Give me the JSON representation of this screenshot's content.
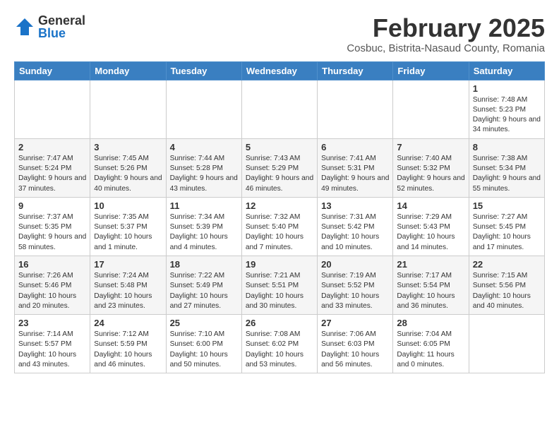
{
  "logo": {
    "general": "General",
    "blue": "Blue"
  },
  "header": {
    "month": "February 2025",
    "location": "Cosbuc, Bistrita-Nasaud County, Romania"
  },
  "days_of_week": [
    "Sunday",
    "Monday",
    "Tuesday",
    "Wednesday",
    "Thursday",
    "Friday",
    "Saturday"
  ],
  "weeks": [
    [
      {
        "day": "",
        "info": ""
      },
      {
        "day": "",
        "info": ""
      },
      {
        "day": "",
        "info": ""
      },
      {
        "day": "",
        "info": ""
      },
      {
        "day": "",
        "info": ""
      },
      {
        "day": "",
        "info": ""
      },
      {
        "day": "1",
        "info": "Sunrise: 7:48 AM\nSunset: 5:23 PM\nDaylight: 9 hours and 34 minutes."
      }
    ],
    [
      {
        "day": "2",
        "info": "Sunrise: 7:47 AM\nSunset: 5:24 PM\nDaylight: 9 hours and 37 minutes."
      },
      {
        "day": "3",
        "info": "Sunrise: 7:45 AM\nSunset: 5:26 PM\nDaylight: 9 hours and 40 minutes."
      },
      {
        "day": "4",
        "info": "Sunrise: 7:44 AM\nSunset: 5:28 PM\nDaylight: 9 hours and 43 minutes."
      },
      {
        "day": "5",
        "info": "Sunrise: 7:43 AM\nSunset: 5:29 PM\nDaylight: 9 hours and 46 minutes."
      },
      {
        "day": "6",
        "info": "Sunrise: 7:41 AM\nSunset: 5:31 PM\nDaylight: 9 hours and 49 minutes."
      },
      {
        "day": "7",
        "info": "Sunrise: 7:40 AM\nSunset: 5:32 PM\nDaylight: 9 hours and 52 minutes."
      },
      {
        "day": "8",
        "info": "Sunrise: 7:38 AM\nSunset: 5:34 PM\nDaylight: 9 hours and 55 minutes."
      }
    ],
    [
      {
        "day": "9",
        "info": "Sunrise: 7:37 AM\nSunset: 5:35 PM\nDaylight: 9 hours and 58 minutes."
      },
      {
        "day": "10",
        "info": "Sunrise: 7:35 AM\nSunset: 5:37 PM\nDaylight: 10 hours and 1 minute."
      },
      {
        "day": "11",
        "info": "Sunrise: 7:34 AM\nSunset: 5:39 PM\nDaylight: 10 hours and 4 minutes."
      },
      {
        "day": "12",
        "info": "Sunrise: 7:32 AM\nSunset: 5:40 PM\nDaylight: 10 hours and 7 minutes."
      },
      {
        "day": "13",
        "info": "Sunrise: 7:31 AM\nSunset: 5:42 PM\nDaylight: 10 hours and 10 minutes."
      },
      {
        "day": "14",
        "info": "Sunrise: 7:29 AM\nSunset: 5:43 PM\nDaylight: 10 hours and 14 minutes."
      },
      {
        "day": "15",
        "info": "Sunrise: 7:27 AM\nSunset: 5:45 PM\nDaylight: 10 hours and 17 minutes."
      }
    ],
    [
      {
        "day": "16",
        "info": "Sunrise: 7:26 AM\nSunset: 5:46 PM\nDaylight: 10 hours and 20 minutes."
      },
      {
        "day": "17",
        "info": "Sunrise: 7:24 AM\nSunset: 5:48 PM\nDaylight: 10 hours and 23 minutes."
      },
      {
        "day": "18",
        "info": "Sunrise: 7:22 AM\nSunset: 5:49 PM\nDaylight: 10 hours and 27 minutes."
      },
      {
        "day": "19",
        "info": "Sunrise: 7:21 AM\nSunset: 5:51 PM\nDaylight: 10 hours and 30 minutes."
      },
      {
        "day": "20",
        "info": "Sunrise: 7:19 AM\nSunset: 5:52 PM\nDaylight: 10 hours and 33 minutes."
      },
      {
        "day": "21",
        "info": "Sunrise: 7:17 AM\nSunset: 5:54 PM\nDaylight: 10 hours and 36 minutes."
      },
      {
        "day": "22",
        "info": "Sunrise: 7:15 AM\nSunset: 5:56 PM\nDaylight: 10 hours and 40 minutes."
      }
    ],
    [
      {
        "day": "23",
        "info": "Sunrise: 7:14 AM\nSunset: 5:57 PM\nDaylight: 10 hours and 43 minutes."
      },
      {
        "day": "24",
        "info": "Sunrise: 7:12 AM\nSunset: 5:59 PM\nDaylight: 10 hours and 46 minutes."
      },
      {
        "day": "25",
        "info": "Sunrise: 7:10 AM\nSunset: 6:00 PM\nDaylight: 10 hours and 50 minutes."
      },
      {
        "day": "26",
        "info": "Sunrise: 7:08 AM\nSunset: 6:02 PM\nDaylight: 10 hours and 53 minutes."
      },
      {
        "day": "27",
        "info": "Sunrise: 7:06 AM\nSunset: 6:03 PM\nDaylight: 10 hours and 56 minutes."
      },
      {
        "day": "28",
        "info": "Sunrise: 7:04 AM\nSunset: 6:05 PM\nDaylight: 11 hours and 0 minutes."
      },
      {
        "day": "",
        "info": ""
      }
    ]
  ]
}
